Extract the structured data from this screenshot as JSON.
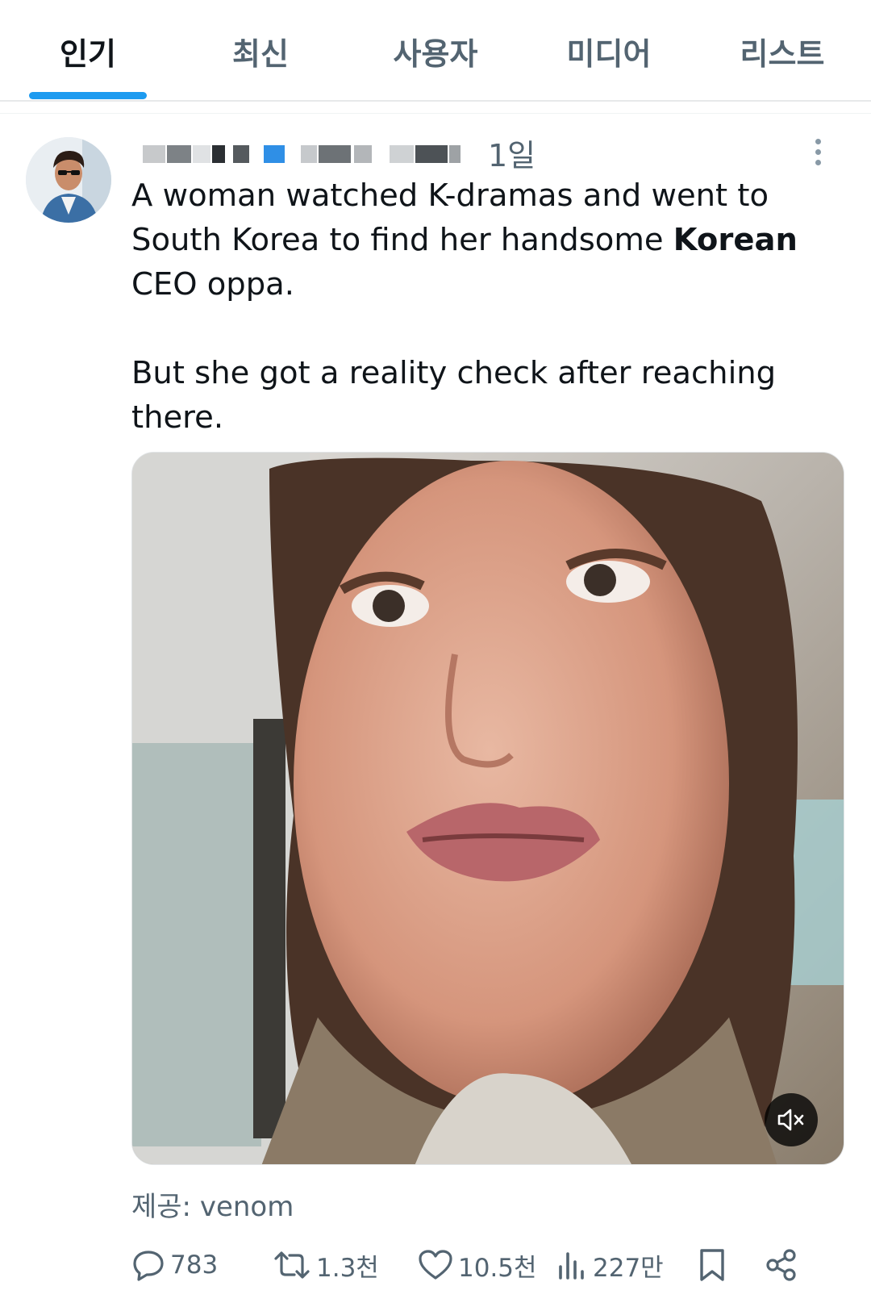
{
  "tabs": [
    {
      "label": "인기",
      "active": true
    },
    {
      "label": "최신",
      "active": false
    },
    {
      "label": "사용자",
      "active": false
    },
    {
      "label": "미디어",
      "active": false
    },
    {
      "label": "리스트",
      "active": false
    }
  ],
  "tweet": {
    "time": "1일",
    "text_before": "A woman watched K-dramas and went to South Korea to find her handsome ",
    "text_bold": "Korean",
    "text_after": " CEO oppa.\n\nBut she got a reality check after reaching there.",
    "credit": "제공:  venom",
    "stats": {
      "replies": "783",
      "retweets": "1.3천",
      "likes": "10.5천",
      "views": "227만"
    }
  },
  "colors": {
    "accent": "#1d9bf0",
    "secondary_text": "#536471",
    "primary_text": "#0f1419"
  }
}
